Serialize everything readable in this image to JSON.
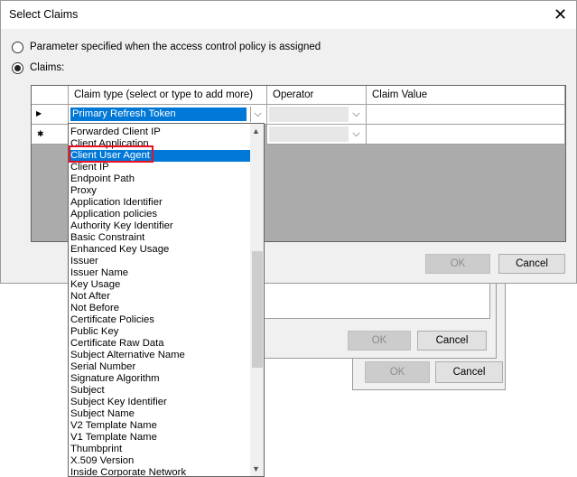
{
  "dialog": {
    "title": "Select Claims",
    "close_glyph": "✕",
    "radio_param": "Parameter specified when the access control policy is assigned",
    "radio_claims": "Claims:",
    "ok_label": "OK",
    "cancel_label": "Cancel"
  },
  "grid": {
    "col_claim_type": "Claim type (select or type to add more)",
    "col_operator": "Operator",
    "col_claim_value": "Claim Value",
    "row1_marker": "▶",
    "row2_marker": "✱",
    "row1_claim_type": "Primary Refresh Token"
  },
  "dropdown": {
    "items": [
      "Forwarded Client IP",
      "Client Application",
      "Client User Agent",
      "Client IP",
      "Endpoint Path",
      "Proxy",
      "Application Identifier",
      "Application policies",
      "Authority Key Identifier",
      "Basic Constraint",
      "Enhanced Key Usage",
      "Issuer",
      "Issuer Name",
      "Key Usage",
      "Not After",
      "Not Before",
      "Certificate Policies",
      "Public Key",
      "Certificate Raw Data",
      "Subject Alternative Name",
      "Serial Number",
      "Signature Algorithm",
      "Subject",
      "Subject Key Identifier",
      "Subject Name",
      "V2 Template Name",
      "V1 Template Name",
      "Thumbprint",
      "X.509 Version",
      "Inside Corporate Network"
    ],
    "selected": "Client User Agent"
  },
  "background_dialogs": {
    "ok_label": "OK",
    "cancel_label": "Cancel"
  },
  "colors": {
    "selection": "#0078d7",
    "highlight_box": "#e81123"
  }
}
